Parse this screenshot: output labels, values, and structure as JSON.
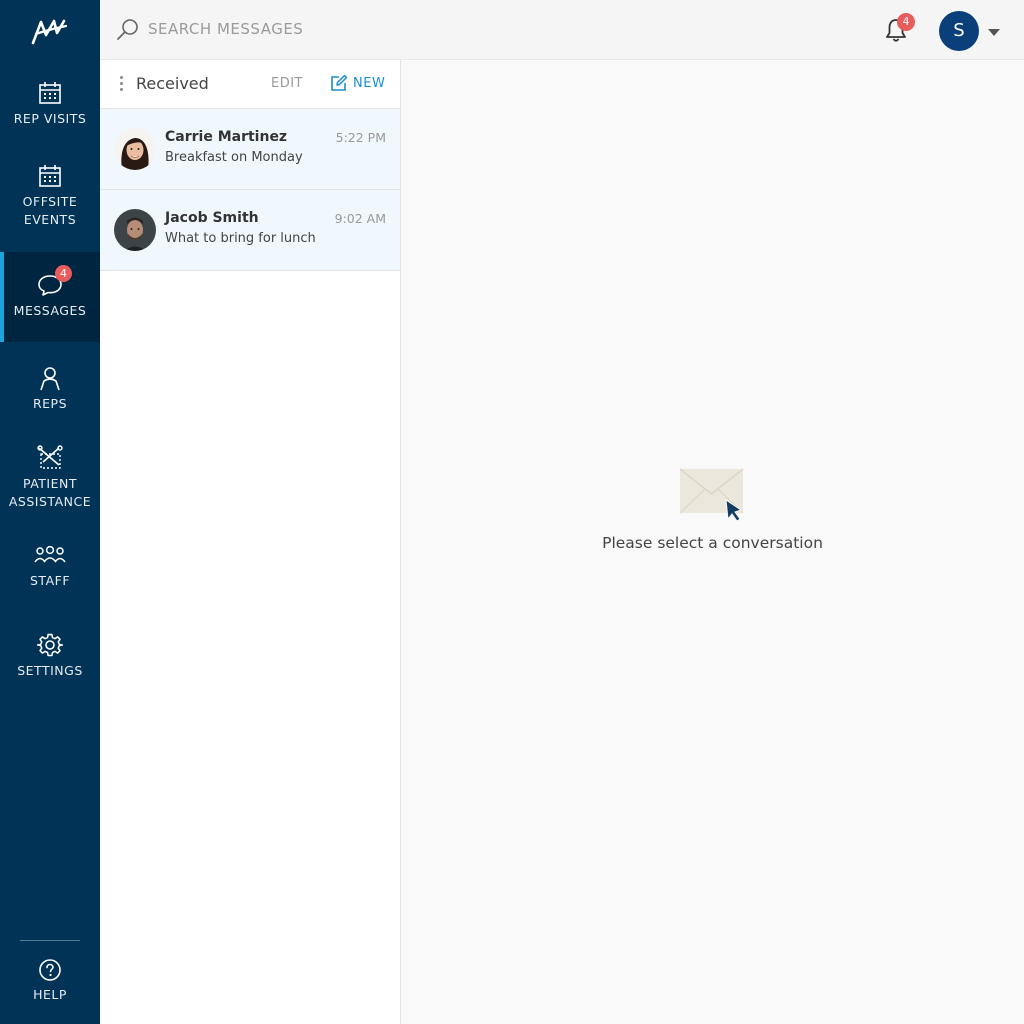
{
  "sidebar": {
    "items": [
      {
        "id": "rep-visits",
        "label": "REP VISITS",
        "icon": "calendar-icon",
        "active": false
      },
      {
        "id": "offsite-events",
        "label": "OFFSITE\nEVENTS",
        "icon": "calendar-icon",
        "active": false
      },
      {
        "id": "messages",
        "label": "MESSAGES",
        "icon": "chat-bubble-icon",
        "active": true,
        "badge": "4"
      },
      {
        "id": "reps",
        "label": "REPS",
        "icon": "person-icon",
        "active": false
      },
      {
        "id": "patient-assistance",
        "label": "PATIENT\nASSISTANCE",
        "icon": "patient-assistance-icon",
        "active": false
      },
      {
        "id": "staff",
        "label": "STAFF",
        "icon": "group-icon",
        "active": false
      },
      {
        "id": "settings",
        "label": "SETTINGS",
        "icon": "gear-icon",
        "active": false
      }
    ],
    "help": {
      "label": "HELP",
      "icon": "help-circle-icon"
    }
  },
  "topbar": {
    "search_placeholder": "SEARCH MESSAGES",
    "notifications_badge": "4",
    "user_initial": "S"
  },
  "list": {
    "folder": "Received",
    "edit_label": "EDIT",
    "new_label": "NEW",
    "messages": [
      {
        "name": "Carrie Martinez",
        "time": "5:22 PM",
        "subject": "Breakfast on Monday"
      },
      {
        "name": "Jacob Smith",
        "time": "9:02 AM",
        "subject": "What to bring for lunch"
      }
    ]
  },
  "content": {
    "empty_text": "Please select a conversation",
    "icon": "envelope-cursor-icon"
  },
  "colors": {
    "sidebar": "#003356",
    "accent": "#1aa6dc",
    "link": "#1a8fd0",
    "badge": "#e85c5c",
    "avatar": "#0a3f7a"
  }
}
